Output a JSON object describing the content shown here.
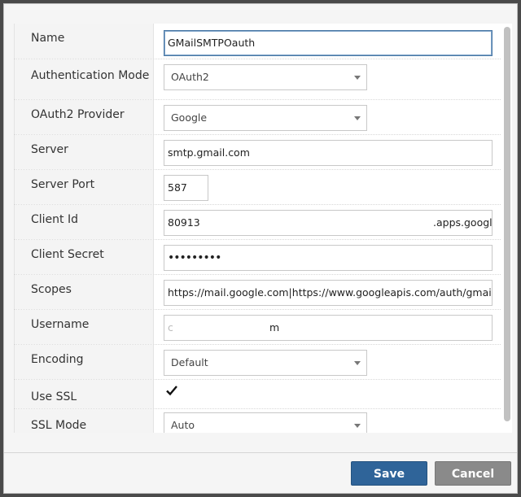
{
  "form": {
    "name": {
      "label": "Name",
      "value": "GMailSMTPOauth"
    },
    "auth_mode": {
      "label": "Authentication Mode",
      "value": "OAuth2"
    },
    "oauth2_provider": {
      "label": "OAuth2 Provider",
      "value": "Google"
    },
    "server": {
      "label": "Server",
      "value": "smtp.gmail.com"
    },
    "server_port": {
      "label": "Server Port",
      "value": "587"
    },
    "client_id": {
      "label": "Client Id",
      "value_start": "80913",
      "value_end": ".apps.google"
    },
    "client_secret": {
      "label": "Client Secret",
      "value": "•••••••••"
    },
    "scopes": {
      "label": "Scopes",
      "value": "https://mail.google.com|https://www.googleapis.com/auth/gmail."
    },
    "username": {
      "label": "Username",
      "value_start": "c",
      "value_end": "m"
    },
    "encoding": {
      "label": "Encoding",
      "value": "Default"
    },
    "use_ssl": {
      "label": "Use SSL",
      "checked": true
    },
    "ssl_mode": {
      "label": "SSL Mode",
      "value": "Auto"
    }
  },
  "footer": {
    "save_label": "Save",
    "cancel_label": "Cancel"
  }
}
